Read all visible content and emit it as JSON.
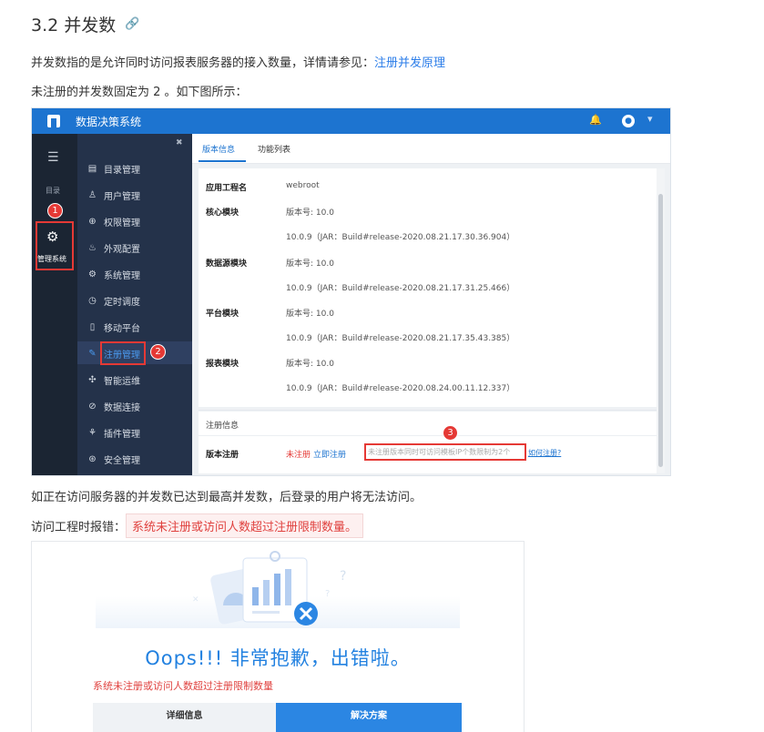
{
  "doc": {
    "heading": "3.2 并发数",
    "p1_text": "并发数指的是允许同时访问报表服务器的接入数量，详情请参见：",
    "p1_link": "注册并发原理",
    "p2": "未注册的并发数固定为 2 。如下图所示：",
    "p3": "如正在访问服务器的并发数已达到最高并发数，后登录的用户将无法访问。",
    "p4_prefix": "访问工程时报错：",
    "p4_error": "系统未注册或访问人数超过注册限制数量。"
  },
  "shot1": {
    "app_title": "数据决策系统",
    "sidebar": {
      "catalog_label": "目录",
      "admin_label": "管理系统"
    },
    "menu": [
      {
        "label": "目录管理",
        "icon": "▤"
      },
      {
        "label": "用户管理",
        "icon": "♙"
      },
      {
        "label": "权限管理",
        "icon": "⊕"
      },
      {
        "label": "外观配置",
        "icon": "♨"
      },
      {
        "label": "系统管理",
        "icon": "⚙"
      },
      {
        "label": "定时调度",
        "icon": "◷"
      },
      {
        "label": "移动平台",
        "icon": "▯"
      },
      {
        "label": "注册管理",
        "icon": "✎"
      },
      {
        "label": "智能运维",
        "icon": "✣"
      },
      {
        "label": "数据连接",
        "icon": "⊘"
      },
      {
        "label": "插件管理",
        "icon": "⚘"
      },
      {
        "label": "安全管理",
        "icon": "⊛"
      }
    ],
    "tabs": [
      "版本信息",
      "功能列表"
    ],
    "project_label": "应用工程名",
    "project_value": "webroot",
    "modules": [
      {
        "name": "核心模块",
        "version": "版本号: 10.0",
        "build": "10.0.9（JAR：Build#release-2020.08.21.17.30.36.904）"
      },
      {
        "name": "数据源模块",
        "version": "版本号: 10.0",
        "build": "10.0.9（JAR：Build#release-2020.08.21.17.31.25.466）"
      },
      {
        "name": "平台模块",
        "version": "版本号: 10.0",
        "build": "10.0.9（JAR：Build#release-2020.08.21.17.35.43.385）"
      },
      {
        "name": "报表模块",
        "version": "版本号: 10.0",
        "build": "10.0.9（JAR：Build#release-2020.08.24.00.11.12.337）"
      }
    ],
    "reg_section_title": "注册信息",
    "reg_label": "版本注册",
    "reg_status": "未注册",
    "reg_now": "立即注册",
    "reg_note": "未注册版本同时可访问模板IP个数限制为2个",
    "reg_help": "如何注册?",
    "badges": [
      "1",
      "2",
      "3"
    ]
  },
  "shot2": {
    "title": "Oops!!! 非常抱歉，出错啦。",
    "message": "系统未注册或访问人数超过注册限制数量",
    "btn_detail": "详细信息",
    "btn_solution": "解决方案"
  },
  "colors": {
    "link": "#2b7de9",
    "topbar": "#1d74d0",
    "sidebar_dark": "#1b2533",
    "sidebar_menu": "#24324a",
    "error_red": "#e0423f",
    "marker_red": "#e53935"
  }
}
